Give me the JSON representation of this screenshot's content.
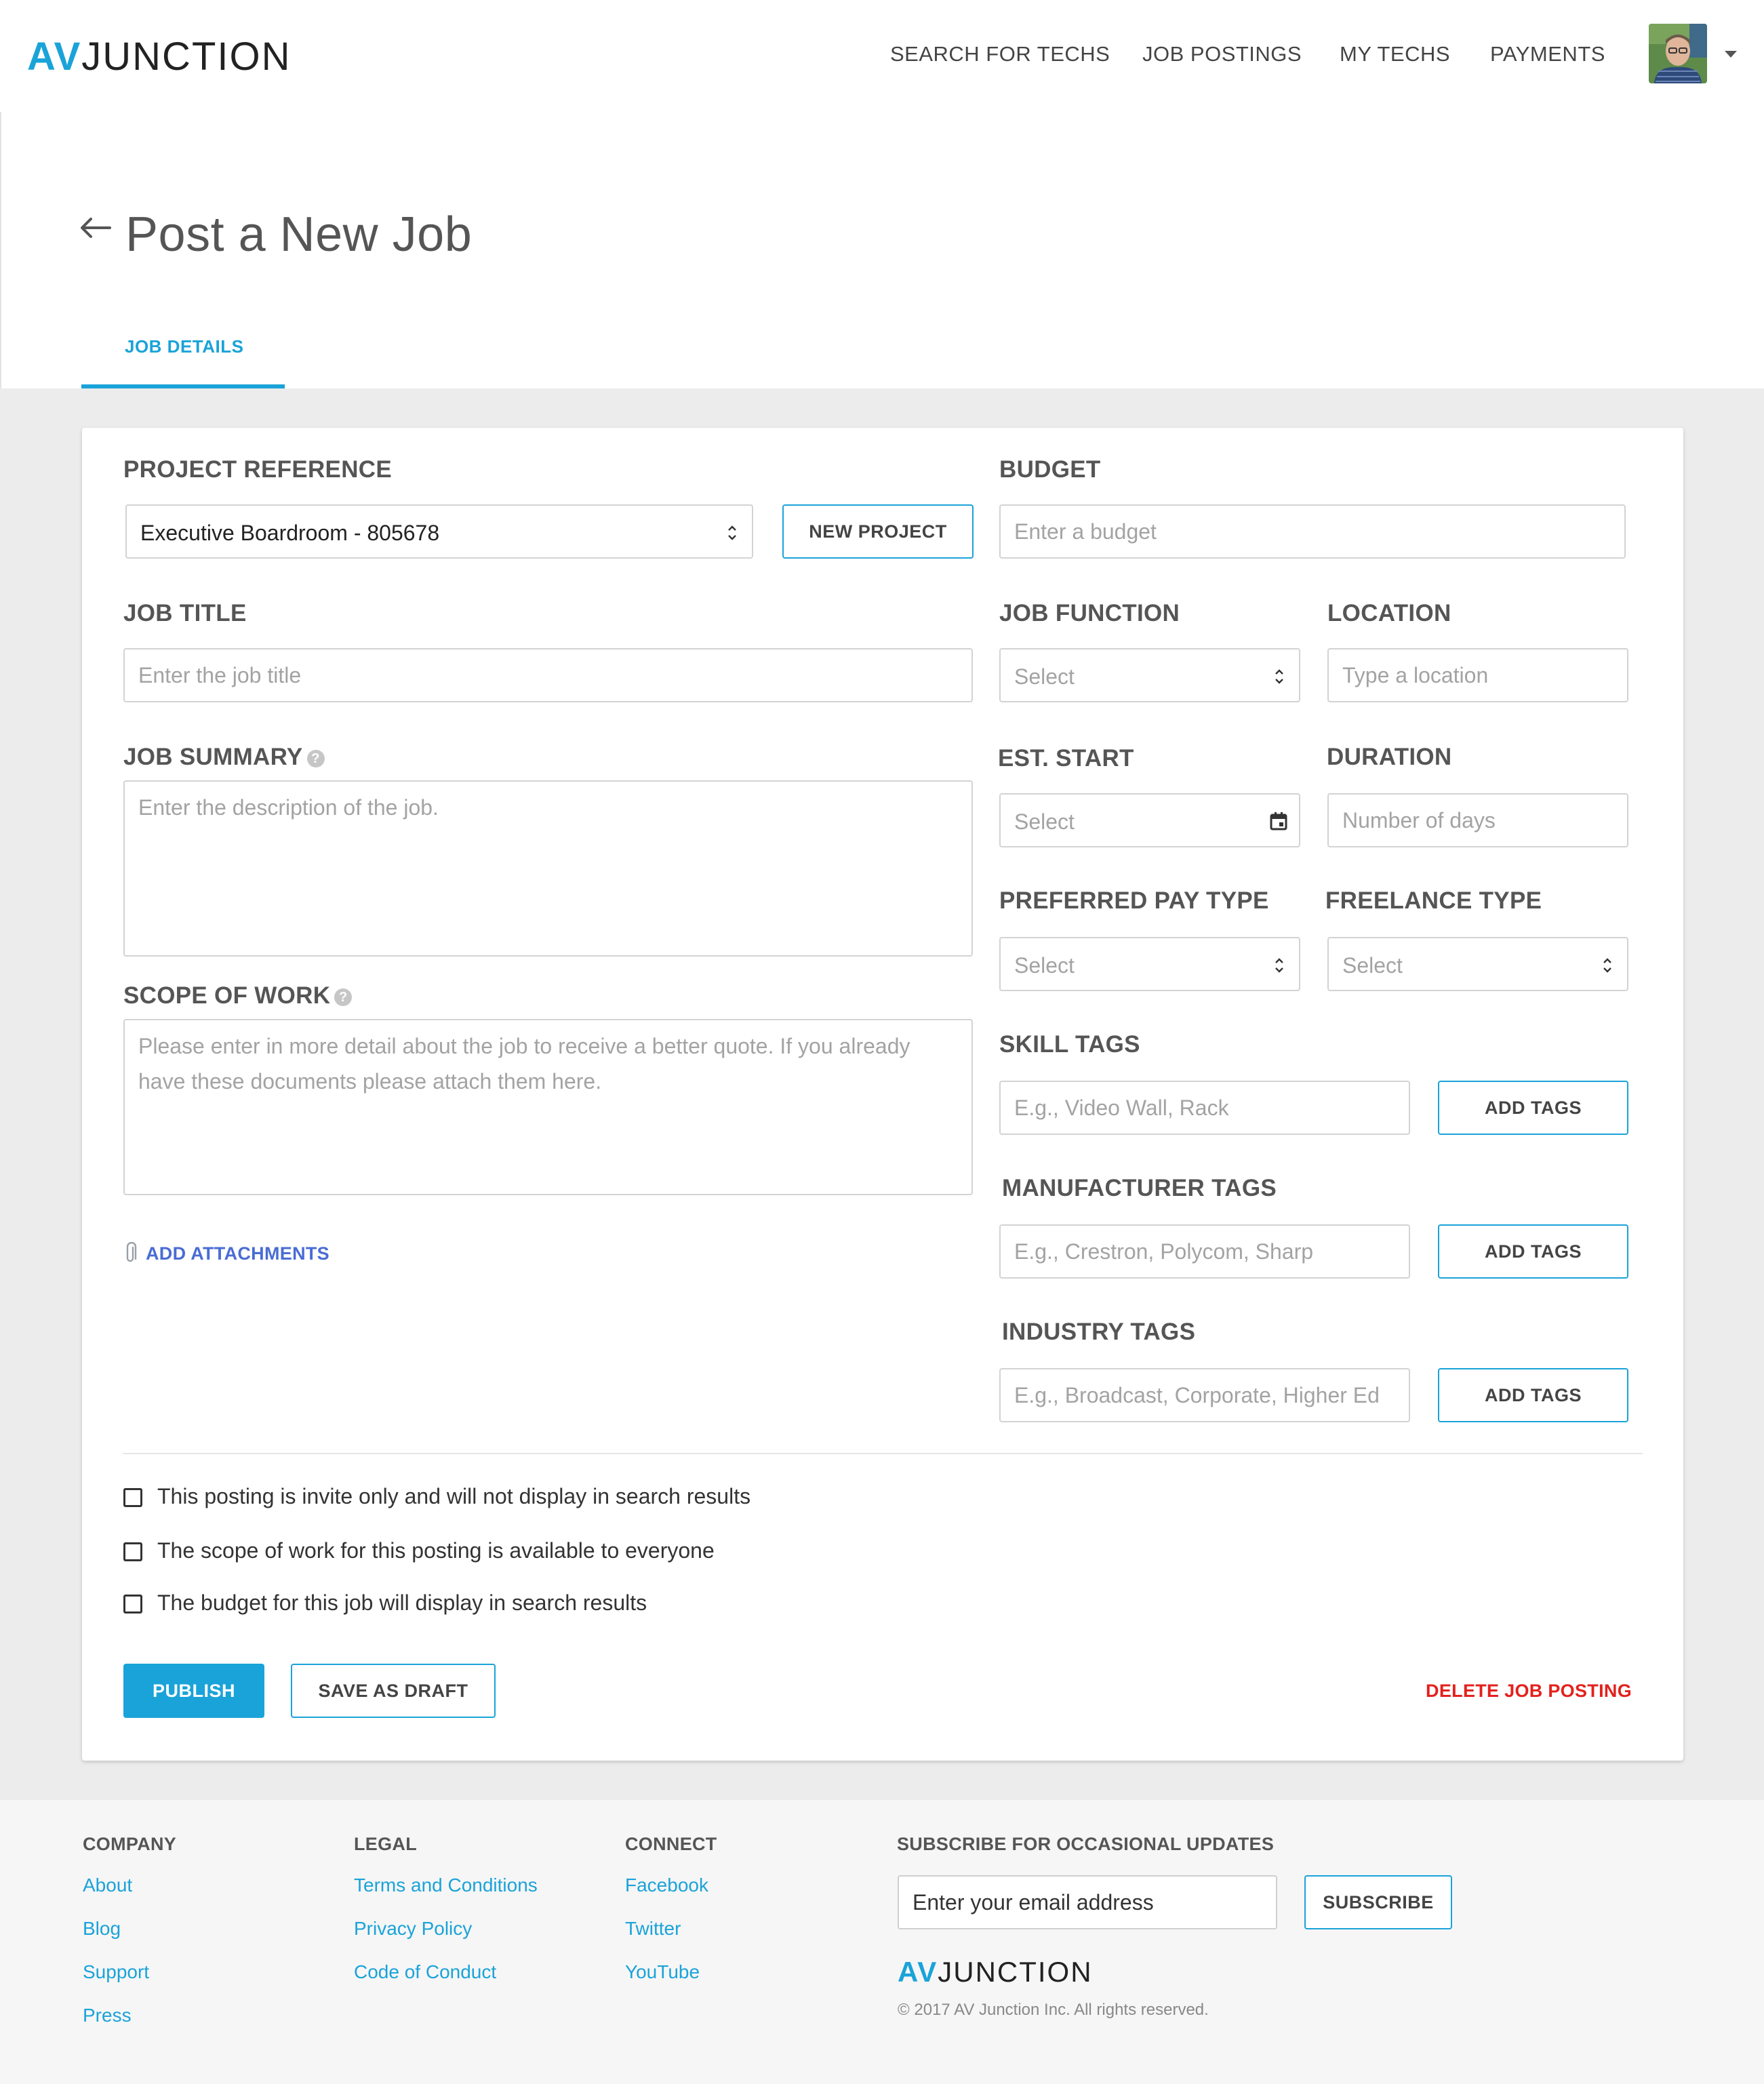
{
  "brand": {
    "logo_prefix": "AV",
    "logo_suffix": "JUNCTION"
  },
  "nav": {
    "items": [
      {
        "label": "SEARCH FOR TECHS"
      },
      {
        "label": "JOB POSTINGS"
      },
      {
        "label": "MY TECHS"
      },
      {
        "label": "PAYMENTS"
      }
    ]
  },
  "page": {
    "title": "Post a New Job",
    "tab": "JOB DETAILS"
  },
  "form": {
    "project_reference": {
      "label": "PROJECT REFERENCE",
      "value": "Executive Boardroom - 805678",
      "new_project_button": "NEW PROJECT"
    },
    "budget": {
      "label": "BUDGET",
      "placeholder": "Enter a budget"
    },
    "job_title": {
      "label": "JOB TITLE",
      "placeholder": "Enter the job title"
    },
    "job_function": {
      "label": "JOB FUNCTION",
      "value": "Select"
    },
    "location": {
      "label": "LOCATION",
      "placeholder": "Type a location"
    },
    "job_summary": {
      "label": "JOB SUMMARY",
      "placeholder": "Enter the description of the job."
    },
    "est_start": {
      "label": "EST. START",
      "value": "Select"
    },
    "duration": {
      "label": "DURATION",
      "placeholder": "Number of days"
    },
    "scope_of_work": {
      "label": "SCOPE OF WORK",
      "placeholder": "Please enter in more detail about the job to receive a better quote. If you already have these documents please attach them here."
    },
    "preferred_pay_type": {
      "label": "PREFERRED PAY TYPE",
      "value": "Select"
    },
    "freelance_type": {
      "label": "FREELANCE TYPE",
      "value": "Select"
    },
    "skill_tags": {
      "label": "SKILL TAGS",
      "placeholder": "E.g., Video Wall, Rack",
      "button": "ADD TAGS"
    },
    "manufacturer_tags": {
      "label": "MANUFACTURER TAGS",
      "placeholder": "E.g., Crestron, Polycom, Sharp",
      "button": "ADD TAGS"
    },
    "industry_tags": {
      "label": "INDUSTRY TAGS",
      "placeholder": "E.g., Broadcast, Corporate, Higher Ed",
      "button": "ADD TAGS"
    },
    "add_attachments": "ADD ATTACHMENTS",
    "checkboxes": [
      {
        "label": "This posting is invite only and will not display in search results",
        "checked": false
      },
      {
        "label": "The scope of work for this posting is available to everyone",
        "checked": false
      },
      {
        "label": "The budget for this job will display in search results",
        "checked": false
      }
    ],
    "publish_button": "PUBLISH",
    "save_draft_button": "SAVE AS DRAFT",
    "delete_button": "DELETE JOB POSTING"
  },
  "footer": {
    "company": {
      "heading": "COMPANY",
      "links": [
        "About",
        "Blog",
        "Support",
        "Press"
      ]
    },
    "legal": {
      "heading": "LEGAL",
      "links": [
        "Terms and Conditions",
        "Privacy Policy",
        "Code of Conduct"
      ]
    },
    "connect": {
      "heading": "CONNECT",
      "links": [
        "Facebook",
        "Twitter",
        "YouTube"
      ]
    },
    "subscribe": {
      "heading": "SUBSCRIBE FOR OCCASIONAL UPDATES",
      "placeholder": "Enter your email address",
      "button": "SUBSCRIBE"
    },
    "copyright": "© 2017 AV Junction Inc. All rights reserved."
  },
  "colors": {
    "accent": "#1aa3d9",
    "danger": "#e3211d",
    "link_alt": "#4a6cd4"
  },
  "icons": [
    "back-arrow-icon",
    "help-icon",
    "updown-chevron-icon",
    "calendar-icon",
    "paperclip-icon",
    "caret-down-icon"
  ]
}
